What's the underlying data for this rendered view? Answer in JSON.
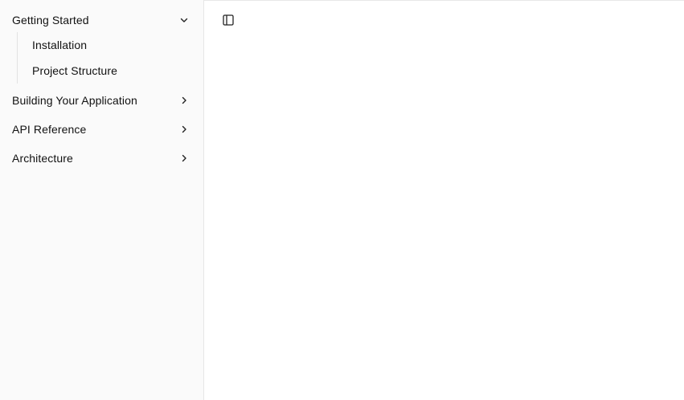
{
  "sidebar": {
    "sections": [
      {
        "label": "Getting Started",
        "expanded": true,
        "icon": "chevron-down-icon",
        "children": [
          {
            "label": "Installation"
          },
          {
            "label": "Project Structure"
          }
        ]
      },
      {
        "label": "Building Your Application",
        "expanded": false,
        "icon": "chevron-right-icon"
      },
      {
        "label": "API Reference",
        "expanded": false,
        "icon": "chevron-right-icon"
      },
      {
        "label": "Architecture",
        "expanded": false,
        "icon": "chevron-right-icon"
      }
    ]
  },
  "main": {
    "toggle_icon": "sidebar-toggle-icon"
  },
  "colors": {
    "sidebar_bg": "#fafafa",
    "border": "#e6e6e6",
    "text": "#111111"
  }
}
